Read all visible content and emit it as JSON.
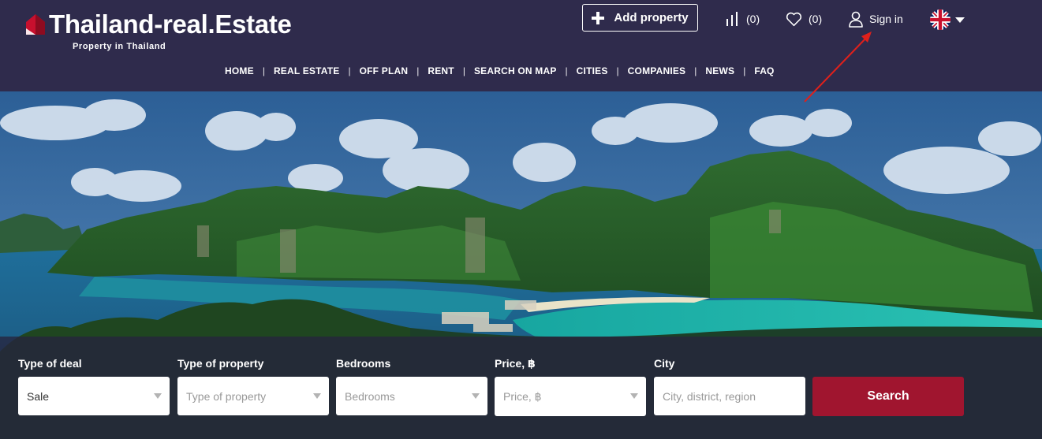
{
  "header": {
    "logo_title": "Thailand-real.Estate",
    "logo_subtitle": "Property in Thailand",
    "add_property_label": "Add property",
    "compare_count": "(0)",
    "favorites_count": "(0)",
    "sign_in_label": "Sign in",
    "language_icon": "uk-flag-icon"
  },
  "nav": {
    "items": [
      "HOME",
      "REAL ESTATE",
      "OFF PLAN",
      "RENT",
      "SEARCH ON MAP",
      "CITIES",
      "COMPANIES",
      "NEWS",
      "FAQ"
    ],
    "separator": "|"
  },
  "search": {
    "deal_label": "Type of deal",
    "deal_value": "Sale",
    "property_label": "Type of property",
    "property_placeholder": "Type of property",
    "bedrooms_label": "Bedrooms",
    "bedrooms_placeholder": "Bedrooms",
    "price_label": "Price, ฿",
    "price_placeholder": "Price, ฿",
    "city_label": "City",
    "city_placeholder": "City, district, region",
    "search_label": "Search"
  },
  "colors": {
    "header_bg": "#2f2b4c",
    "accent_red": "#a0152f",
    "annotation_arrow": "#e0201b"
  }
}
